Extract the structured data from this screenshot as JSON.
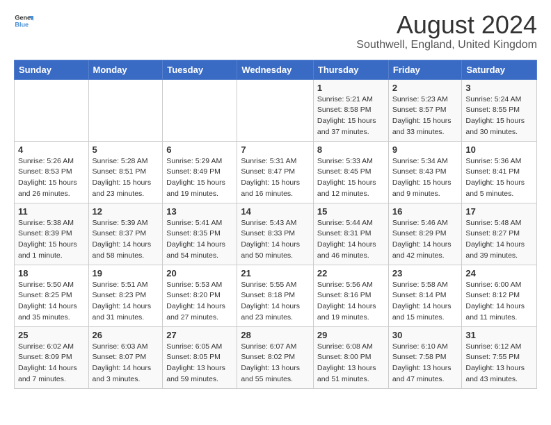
{
  "logo": {
    "text_general": "General",
    "text_blue": "Blue"
  },
  "title": "August 2024",
  "subtitle": "Southwell, England, United Kingdom",
  "days_of_week": [
    "Sunday",
    "Monday",
    "Tuesday",
    "Wednesday",
    "Thursday",
    "Friday",
    "Saturday"
  ],
  "weeks": [
    [
      {
        "day": "",
        "info": ""
      },
      {
        "day": "",
        "info": ""
      },
      {
        "day": "",
        "info": ""
      },
      {
        "day": "",
        "info": ""
      },
      {
        "day": "1",
        "info": "Sunrise: 5:21 AM\nSunset: 8:58 PM\nDaylight: 15 hours\nand 37 minutes."
      },
      {
        "day": "2",
        "info": "Sunrise: 5:23 AM\nSunset: 8:57 PM\nDaylight: 15 hours\nand 33 minutes."
      },
      {
        "day": "3",
        "info": "Sunrise: 5:24 AM\nSunset: 8:55 PM\nDaylight: 15 hours\nand 30 minutes."
      }
    ],
    [
      {
        "day": "4",
        "info": "Sunrise: 5:26 AM\nSunset: 8:53 PM\nDaylight: 15 hours\nand 26 minutes."
      },
      {
        "day": "5",
        "info": "Sunrise: 5:28 AM\nSunset: 8:51 PM\nDaylight: 15 hours\nand 23 minutes."
      },
      {
        "day": "6",
        "info": "Sunrise: 5:29 AM\nSunset: 8:49 PM\nDaylight: 15 hours\nand 19 minutes."
      },
      {
        "day": "7",
        "info": "Sunrise: 5:31 AM\nSunset: 8:47 PM\nDaylight: 15 hours\nand 16 minutes."
      },
      {
        "day": "8",
        "info": "Sunrise: 5:33 AM\nSunset: 8:45 PM\nDaylight: 15 hours\nand 12 minutes."
      },
      {
        "day": "9",
        "info": "Sunrise: 5:34 AM\nSunset: 8:43 PM\nDaylight: 15 hours\nand 9 minutes."
      },
      {
        "day": "10",
        "info": "Sunrise: 5:36 AM\nSunset: 8:41 PM\nDaylight: 15 hours\nand 5 minutes."
      }
    ],
    [
      {
        "day": "11",
        "info": "Sunrise: 5:38 AM\nSunset: 8:39 PM\nDaylight: 15 hours\nand 1 minute."
      },
      {
        "day": "12",
        "info": "Sunrise: 5:39 AM\nSunset: 8:37 PM\nDaylight: 14 hours\nand 58 minutes."
      },
      {
        "day": "13",
        "info": "Sunrise: 5:41 AM\nSunset: 8:35 PM\nDaylight: 14 hours\nand 54 minutes."
      },
      {
        "day": "14",
        "info": "Sunrise: 5:43 AM\nSunset: 8:33 PM\nDaylight: 14 hours\nand 50 minutes."
      },
      {
        "day": "15",
        "info": "Sunrise: 5:44 AM\nSunset: 8:31 PM\nDaylight: 14 hours\nand 46 minutes."
      },
      {
        "day": "16",
        "info": "Sunrise: 5:46 AM\nSunset: 8:29 PM\nDaylight: 14 hours\nand 42 minutes."
      },
      {
        "day": "17",
        "info": "Sunrise: 5:48 AM\nSunset: 8:27 PM\nDaylight: 14 hours\nand 39 minutes."
      }
    ],
    [
      {
        "day": "18",
        "info": "Sunrise: 5:50 AM\nSunset: 8:25 PM\nDaylight: 14 hours\nand 35 minutes."
      },
      {
        "day": "19",
        "info": "Sunrise: 5:51 AM\nSunset: 8:23 PM\nDaylight: 14 hours\nand 31 minutes."
      },
      {
        "day": "20",
        "info": "Sunrise: 5:53 AM\nSunset: 8:20 PM\nDaylight: 14 hours\nand 27 minutes."
      },
      {
        "day": "21",
        "info": "Sunrise: 5:55 AM\nSunset: 8:18 PM\nDaylight: 14 hours\nand 23 minutes."
      },
      {
        "day": "22",
        "info": "Sunrise: 5:56 AM\nSunset: 8:16 PM\nDaylight: 14 hours\nand 19 minutes."
      },
      {
        "day": "23",
        "info": "Sunrise: 5:58 AM\nSunset: 8:14 PM\nDaylight: 14 hours\nand 15 minutes."
      },
      {
        "day": "24",
        "info": "Sunrise: 6:00 AM\nSunset: 8:12 PM\nDaylight: 14 hours\nand 11 minutes."
      }
    ],
    [
      {
        "day": "25",
        "info": "Sunrise: 6:02 AM\nSunset: 8:09 PM\nDaylight: 14 hours\nand 7 minutes."
      },
      {
        "day": "26",
        "info": "Sunrise: 6:03 AM\nSunset: 8:07 PM\nDaylight: 14 hours\nand 3 minutes."
      },
      {
        "day": "27",
        "info": "Sunrise: 6:05 AM\nSunset: 8:05 PM\nDaylight: 13 hours\nand 59 minutes."
      },
      {
        "day": "28",
        "info": "Sunrise: 6:07 AM\nSunset: 8:02 PM\nDaylight: 13 hours\nand 55 minutes."
      },
      {
        "day": "29",
        "info": "Sunrise: 6:08 AM\nSunset: 8:00 PM\nDaylight: 13 hours\nand 51 minutes."
      },
      {
        "day": "30",
        "info": "Sunrise: 6:10 AM\nSunset: 7:58 PM\nDaylight: 13 hours\nand 47 minutes."
      },
      {
        "day": "31",
        "info": "Sunrise: 6:12 AM\nSunset: 7:55 PM\nDaylight: 13 hours\nand 43 minutes."
      }
    ]
  ]
}
